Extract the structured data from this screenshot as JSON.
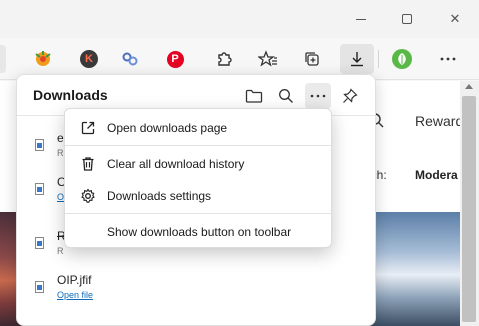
{
  "window": {
    "minimize_icon": "minimize-icon",
    "maximize_icon": "maximize-icon",
    "close_label": "✕"
  },
  "toolbar": {
    "cut_tab_label": "s",
    "ext_k_label": "K",
    "ext_p_label": "P",
    "icons": [
      "extension-sq-icon",
      "extension-k-icon",
      "link-extension-icon",
      "pinterest-icon",
      "extensions-icon",
      "favorites-icon",
      "collections-icon",
      "downloads-icon",
      "leaf-extension-icon",
      "more-icon"
    ]
  },
  "page": {
    "rewards_label": "Reward",
    "search_label": "arch:",
    "moderate_label": "Modera"
  },
  "downloads": {
    "title": "Downloads",
    "items": [
      {
        "name": "e",
        "status": "R"
      },
      {
        "name": "O",
        "status": "O"
      },
      {
        "name": "R",
        "status": "R"
      },
      {
        "name": "OIP.jfif",
        "status": "Open file"
      }
    ]
  },
  "menu": {
    "items": [
      {
        "label": "Open downloads page",
        "icon": "open-external-icon"
      },
      {
        "label": "Clear all download history",
        "icon": "trash-icon"
      },
      {
        "label": "Downloads settings",
        "icon": "gear-icon"
      },
      {
        "label": "Show downloads button on toolbar",
        "icon": ""
      }
    ]
  },
  "colors": {
    "accent_link": "#0f6cbd",
    "pinterest": "#e60023",
    "leaf": "#58b947"
  }
}
